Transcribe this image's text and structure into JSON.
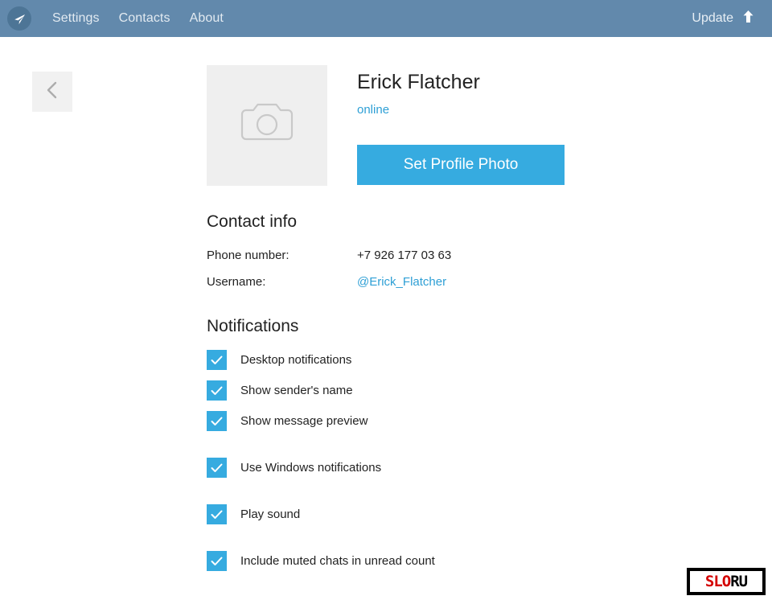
{
  "header": {
    "logo_icon": "telegram-paper-plane-icon",
    "nav": [
      {
        "label": "Settings"
      },
      {
        "label": "Contacts"
      },
      {
        "label": "About"
      }
    ],
    "update": {
      "label": "Update",
      "icon": "arrow-up-icon"
    },
    "background_color": "#6289ac"
  },
  "back_button": {
    "icon": "chevron-left-icon"
  },
  "profile": {
    "photo_placeholder_icon": "camera-icon",
    "name": "Erick Flatcher",
    "status": "online",
    "status_color": "#2e9fd5",
    "set_photo_button": "Set Profile Photo",
    "accent_color": "#36abe0"
  },
  "contact_info": {
    "title": "Contact info",
    "rows": [
      {
        "label": "Phone number:",
        "value": "+7 926 177 03 63",
        "is_link": false
      },
      {
        "label": "Username:",
        "value": "@Erick_Flatcher",
        "is_link": true
      }
    ]
  },
  "notifications": {
    "title": "Notifications",
    "items": [
      {
        "label": "Desktop notifications",
        "checked": true
      },
      {
        "label": "Show sender's name",
        "checked": true
      },
      {
        "label": "Show message preview",
        "checked": true
      },
      {
        "label": "Use Windows notifications",
        "checked": true
      },
      {
        "label": "Play sound",
        "checked": true
      },
      {
        "label": "Include muted chats in unread count",
        "checked": true
      }
    ],
    "checkbox_color": "#36abe0"
  },
  "watermark": {
    "text_red": "SLO",
    "text_black": "RU",
    "red_color": "#d40000"
  }
}
